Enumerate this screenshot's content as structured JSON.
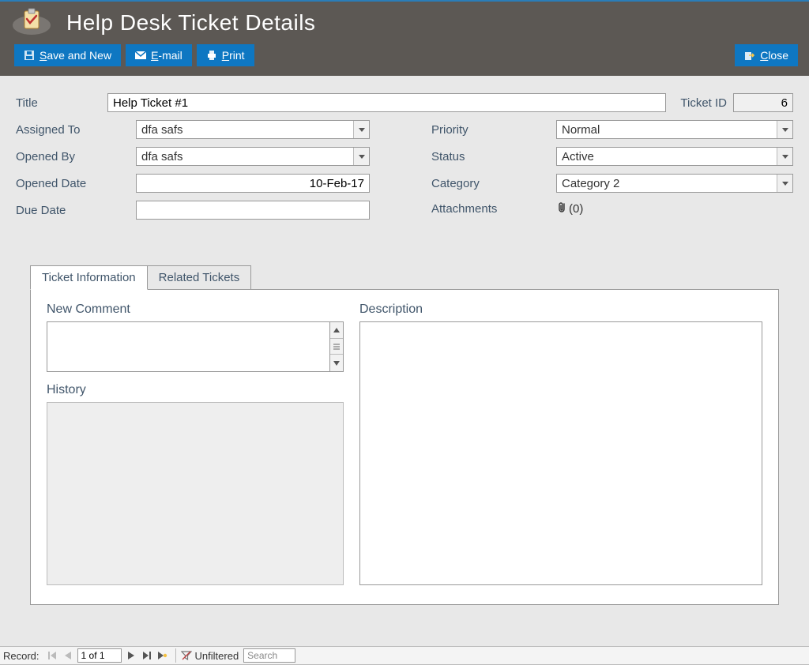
{
  "header": {
    "title": "Help Desk Ticket Details"
  },
  "toolbar": {
    "save_and_new": "Save and New",
    "email": "E-mail",
    "print": "Print",
    "close": "Close"
  },
  "form": {
    "title_label": "Title",
    "title_value": "Help Ticket #1",
    "ticket_id_label": "Ticket ID",
    "ticket_id_value": "6",
    "assigned_to_label": "Assigned To",
    "assigned_to_value": "dfa safs",
    "opened_by_label": "Opened By",
    "opened_by_value": "dfa safs",
    "opened_date_label": "Opened Date",
    "opened_date_value": "10-Feb-17",
    "due_date_label": "Due Date",
    "due_date_value": "",
    "priority_label": "Priority",
    "priority_value": "Normal",
    "status_label": "Status",
    "status_value": "Active",
    "category_label": "Category",
    "category_value": "Category 2",
    "attachments_label": "Attachments",
    "attachments_count": "(0)"
  },
  "tabs": {
    "ticket_info": "Ticket Information",
    "related": "Related Tickets"
  },
  "panel": {
    "new_comment_label": "New Comment",
    "history_label": "History",
    "description_label": "Description"
  },
  "recordnav": {
    "label": "Record:",
    "position": "1 of 1",
    "filter_label": "Unfiltered",
    "search_placeholder": "Search"
  }
}
